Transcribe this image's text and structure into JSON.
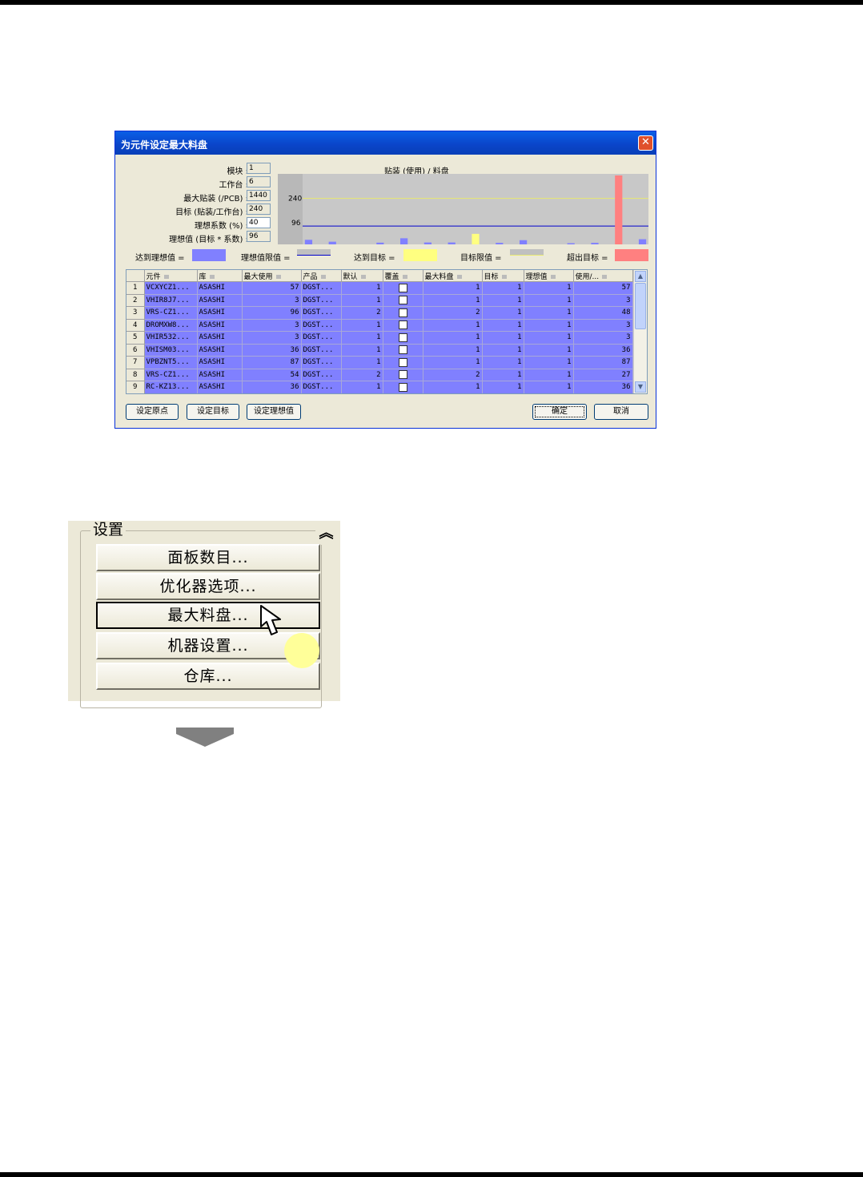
{
  "dialog": {
    "title": "为元件设定最大料盘",
    "close": "✕",
    "fields": [
      {
        "label": "模块 :",
        "value": "1"
      },
      {
        "label": "工作台 :",
        "value": "6"
      },
      {
        "label": "最大贴装 (/PCB) :",
        "value": "1440"
      },
      {
        "label": "目标 (贴装/工作台) :",
        "value": "240"
      },
      {
        "label": "理想系数 (%) :",
        "value": "40"
      },
      {
        "label": "理想值 (目标 * 系数) :",
        "value": "96"
      }
    ],
    "chart_title": "贴装 (使用) / 料盘",
    "legend": {
      "reached_ideal": "达到理想值 =",
      "ideal_limit": "理想值限值 =",
      "reached_target": "达到目标 =",
      "target_limit": "目标限值 =",
      "over_target": "超出目标 ="
    },
    "colors": {
      "ideal": "#8080ff",
      "target": "#ffff80",
      "over": "#ff8080",
      "ideal_line": "#0000cc",
      "target_line": "#e8e870"
    },
    "table": {
      "headers": [
        "元件",
        "库",
        "最大使用",
        "产品",
        "默认",
        "覆盖",
        "最大料盘",
        "目标",
        "理想值",
        "使用/..."
      ],
      "rows": [
        {
          "n": "1",
          "part": "VCXYCZ1...",
          "lib": "ASASHI",
          "max_use": "57",
          "product": "DGST...",
          "default": "1",
          "max_tray": "1",
          "target": "1",
          "ideal": "1",
          "use": "57"
        },
        {
          "n": "2",
          "part": "VHIR8J7...",
          "lib": "ASASHI",
          "max_use": "3",
          "product": "DGST...",
          "default": "1",
          "max_tray": "1",
          "target": "1",
          "ideal": "1",
          "use": "3"
        },
        {
          "n": "3",
          "part": "VRS-CZ1...",
          "lib": "ASASHI",
          "max_use": "96",
          "product": "DGST...",
          "default": "2",
          "max_tray": "2",
          "target": "1",
          "ideal": "1",
          "use": "48"
        },
        {
          "n": "4",
          "part": "DROMXW8...",
          "lib": "ASASHI",
          "max_use": "3",
          "product": "DGST...",
          "default": "1",
          "max_tray": "1",
          "target": "1",
          "ideal": "1",
          "use": "3"
        },
        {
          "n": "5",
          "part": "VHIR532...",
          "lib": "ASASHI",
          "max_use": "3",
          "product": "DGST...",
          "default": "1",
          "max_tray": "1",
          "target": "1",
          "ideal": "1",
          "use": "3"
        },
        {
          "n": "6",
          "part": "VHISM03...",
          "lib": "ASASHI",
          "max_use": "36",
          "product": "DGST...",
          "default": "1",
          "max_tray": "1",
          "target": "1",
          "ideal": "1",
          "use": "36"
        },
        {
          "n": "7",
          "part": "VPBZNT5...",
          "lib": "ASASHI",
          "max_use": "87",
          "product": "DGST...",
          "default": "1",
          "max_tray": "1",
          "target": "1",
          "ideal": "1",
          "use": "87"
        },
        {
          "n": "8",
          "part": "VRS-CZ1...",
          "lib": "ASASHI",
          "max_use": "54",
          "product": "DGST...",
          "default": "2",
          "max_tray": "2",
          "target": "1",
          "ideal": "1",
          "use": "27"
        },
        {
          "n": "9",
          "part": "RC-KZ13...",
          "lib": "ASASHI",
          "max_use": "36",
          "product": "DGST...",
          "default": "1",
          "max_tray": "1",
          "target": "1",
          "ideal": "1",
          "use": "36"
        }
      ]
    },
    "buttons": {
      "set_origin": "设定原点",
      "set_target": "设定目标",
      "set_ideal": "设定理想值",
      "ok": "确定",
      "cancel": "取消"
    }
  },
  "chart_data": {
    "type": "bar",
    "title": "贴装 (使用) / 料盘",
    "xlabel": "",
    "ylabel": "",
    "yticks": [
      "240",
      "96"
    ],
    "ideal_value": 96,
    "target_value": 240,
    "values": [
      24,
      0,
      14,
      0,
      0,
      0,
      9,
      0,
      32,
      0,
      10,
      0,
      10,
      0,
      55,
      0,
      8,
      0,
      22,
      0,
      0,
      0,
      6,
      0,
      8,
      0,
      360,
      0,
      27
    ],
    "ylim": [
      0,
      360
    ]
  },
  "settings": {
    "group_label": "设置",
    "collapse": "︽",
    "buttons": [
      "面板数目...",
      "优化器选项...",
      "最大料盘...",
      "机器设置...",
      "仓库..."
    ]
  }
}
